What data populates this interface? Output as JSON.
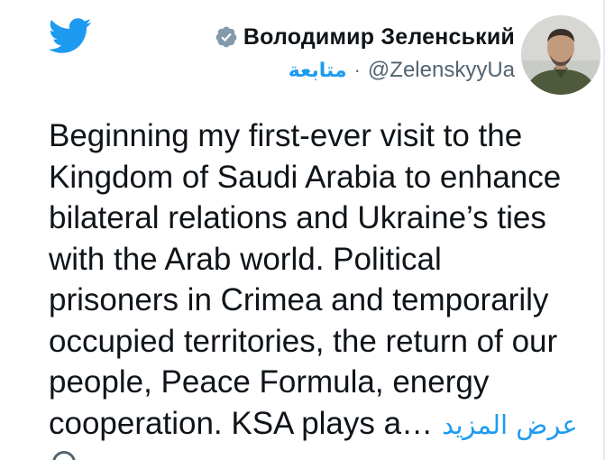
{
  "colors": {
    "twitter_blue": "#1d9bf0",
    "text_primary": "#0f1419",
    "text_secondary": "#536471",
    "verified_gray": "#829aab"
  },
  "header": {
    "logo_icon": "twitter-bird-icon",
    "display_name": "Володимир Зеленський",
    "verified_icon": "verified-badge-icon",
    "handle": "@ZelenskyyUa",
    "separator": "·",
    "follow_label": "متابعة",
    "avatar_icon": "profile-avatar"
  },
  "tweet": {
    "lines": [
      "Beginning my first-ever visit to the",
      "Kingdom of Saudi Arabia to enhance",
      "bilateral relations and Ukraine’s ties",
      "with the Arab world. Political",
      "prisoners in Crimea and temporarily",
      "occupied territories, the return of our",
      "people, Peace Formula, energy",
      "cooperation. KSA plays a…"
    ],
    "show_more_label": "عرض المزيد"
  }
}
